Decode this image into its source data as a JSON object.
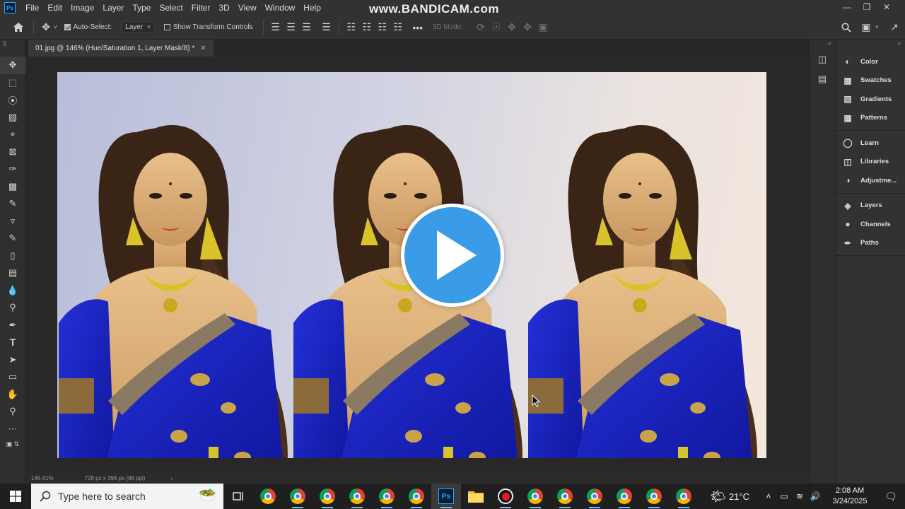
{
  "menubar": {
    "app_icon": "Ps",
    "items": [
      "File",
      "Edit",
      "Image",
      "Layer",
      "Type",
      "Select",
      "Filter",
      "3D",
      "View",
      "Window",
      "Help"
    ],
    "watermark": "www.BANDICAM.com"
  },
  "options": {
    "auto_select_label": "Auto-Select:",
    "auto_select_checked": true,
    "layer_select_value": "Layer",
    "transform_controls_label": "Show Transform Controls",
    "transform_controls_checked": false,
    "mode_3d_label": "3D Mode:"
  },
  "document": {
    "tab_title": "01.jpg @ 146% (Hue/Saturation 1, Layer Mask/8) *",
    "zoom": "146.41%",
    "doc_info": "728 px x 396 px (96 ppi)"
  },
  "panels": {
    "group1": [
      "Color",
      "Swatches",
      "Gradients",
      "Patterns"
    ],
    "group2": [
      "Learn",
      "Libraries",
      "Adjustme..."
    ],
    "group3": [
      "Layers",
      "Channels",
      "Paths"
    ]
  },
  "taskbar": {
    "search_placeholder": "Type here to search",
    "weather_temp": "21°C",
    "time": "2:08 AM",
    "date": "3/24/2025"
  },
  "colors": {
    "saree_blue": "#1b22c8",
    "play_button": "#3a9be6",
    "gold": "#d8c42a"
  },
  "tool_icons": [
    "move-icon",
    "marquee-icon",
    "lasso-icon",
    "object-select-icon",
    "crop-icon",
    "frame-icon",
    "eyedropper-icon",
    "healing-brush-icon",
    "brush-icon",
    "clone-stamp-icon",
    "history-brush-icon",
    "eraser-icon",
    "gradient-icon",
    "blur-icon",
    "dodge-icon",
    "pen-icon",
    "type-icon",
    "path-select-icon",
    "rectangle-icon",
    "hand-icon",
    "zoom-icon",
    "more-tools-icon"
  ]
}
